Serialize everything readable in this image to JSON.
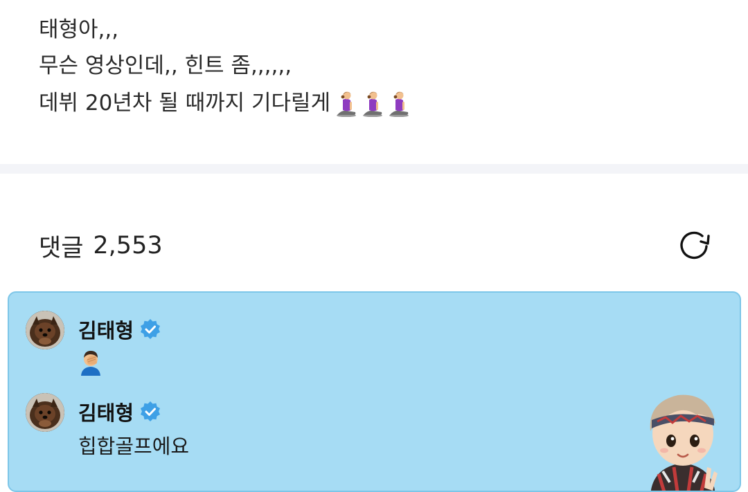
{
  "post": {
    "lines": [
      "태형아,,,",
      "무슨 영상인데,, 힌트 좀,,,,,,",
      "데뷔 20년차 될 때까지 기다릴게"
    ],
    "trailing_emoji": "person-kneeling-icon"
  },
  "comments_section": {
    "label": "댓글",
    "count": "2,553",
    "refresh_icon": "refresh-icon"
  },
  "highlighted_card": {
    "background": "#a6dcf4",
    "border": "#7dc6e8",
    "comments": [
      {
        "author": "김태형",
        "verified": true,
        "body_type": "emoji",
        "body_icon": "person-facepalming-icon",
        "body_text": ""
      },
      {
        "author": "김태형",
        "verified": true,
        "body_type": "text",
        "body_text": "힙합골프에요"
      }
    ],
    "sticker": "character-sticker"
  },
  "colors": {
    "verified_badge": "#3ea0e6",
    "separator": "#f3f4f8"
  }
}
